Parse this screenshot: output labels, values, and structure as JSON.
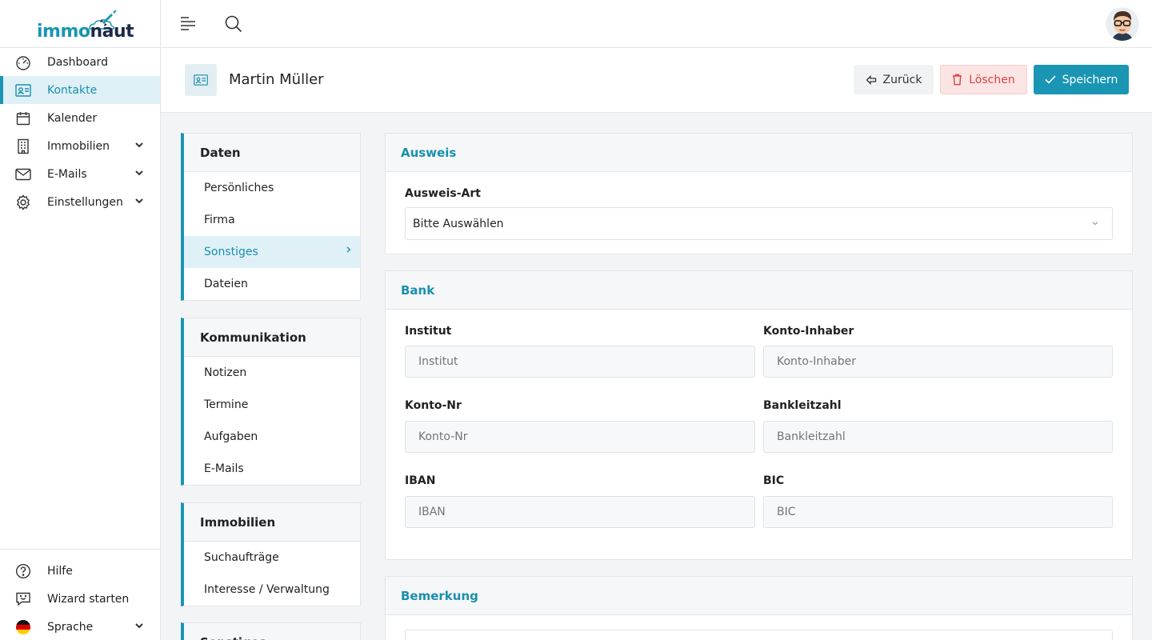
{
  "logo": {
    "part1": "immo",
    "part2": "naut"
  },
  "colors": {
    "accent": "#1a95b3",
    "danger": "#d9443f",
    "active_bg": "#dff1f6"
  },
  "sidebar": {
    "items": [
      {
        "label": "Dashboard",
        "icon": "gauge-icon"
      },
      {
        "label": "Kontakte",
        "icon": "contact-card-icon",
        "active": true
      },
      {
        "label": "Kalender",
        "icon": "calendar-icon"
      },
      {
        "label": "Immobilien",
        "icon": "building-icon",
        "expandable": true
      },
      {
        "label": "E-Mails",
        "icon": "mail-icon",
        "expandable": true
      },
      {
        "label": "Einstellungen",
        "icon": "gear-icon",
        "expandable": true
      }
    ],
    "bottom": [
      {
        "label": "Hilfe",
        "icon": "help-icon"
      },
      {
        "label": "Wizard starten",
        "icon": "chat-smile-icon"
      },
      {
        "label": "Sprache",
        "icon": "flag-de-icon",
        "expandable": true
      }
    ]
  },
  "header": {
    "title": "Martin Müller",
    "back_label": "Zurück",
    "delete_label": "Löschen",
    "save_label": "Speichern"
  },
  "submenus": {
    "daten": {
      "title": "Daten",
      "items": [
        "Persönliches",
        "Firma",
        "Sonstiges",
        "Dateien"
      ],
      "active": "Sonstiges"
    },
    "kommunikation": {
      "title": "Kommunikation",
      "items": [
        "Notizen",
        "Termine",
        "Aufgaben",
        "E-Mails"
      ]
    },
    "immobilien": {
      "title": "Immobilien",
      "items": [
        "Suchaufträge",
        "Interesse / Verwaltung"
      ]
    },
    "sonstiges": {
      "title": "Sonstiges"
    }
  },
  "ausweis": {
    "title": "Ausweis",
    "type_label": "Ausweis-Art",
    "type_value": "Bitte Auswählen"
  },
  "bank": {
    "title": "Bank",
    "institut_label": "Institut",
    "institut_placeholder": "Institut",
    "inhaber_label": "Konto-Inhaber",
    "inhaber_placeholder": "Konto-Inhaber",
    "kontonr_label": "Konto-Nr",
    "kontonr_placeholder": "Konto-Nr",
    "blz_label": "Bankleitzahl",
    "blz_placeholder": "Bankleitzahl",
    "iban_label": "IBAN",
    "iban_placeholder": "IBAN",
    "bic_label": "BIC",
    "bic_placeholder": "BIC"
  },
  "bemerkung": {
    "title": "Bemerkung"
  }
}
